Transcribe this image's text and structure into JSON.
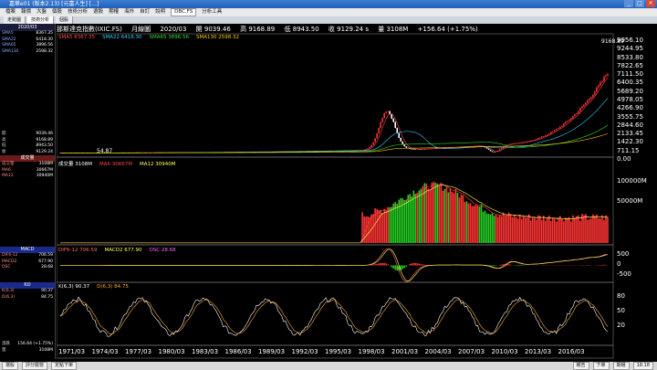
{
  "window": {
    "title": "嘉華e01 (版本2.13) [元富人生] [...]"
  },
  "menu": {
    "items": [
      "檔案",
      "報價",
      "大盤",
      "個股",
      "技術分析",
      "選股",
      "期權",
      "海外",
      "自訂",
      "說明"
    ],
    "symbol_value": "DBC.FS",
    "analysis_tool": "分析工具"
  },
  "tabs": [
    {
      "label": "走勢圖",
      "active": false
    },
    {
      "label": "技術分析",
      "active": true
    },
    {
      "label": "個股",
      "active": false
    }
  ],
  "header": {
    "name": "那斯達克指數(IXIC.FS)",
    "period": "月線圖",
    "date": "2020/03",
    "open_label": "開",
    "open": "9039.46",
    "high_label": "高",
    "high": "9168.89",
    "low_label": "低",
    "low": "8943.50",
    "close_label": "收",
    "close": "9129.24 s",
    "vol_label": "量",
    "vol": "3108M",
    "change": "+156.64 (+1.75%)"
  },
  "price_indicators": [
    {
      "label": "SMA5 8367.35",
      "color": "#ff4444"
    },
    {
      "label": "SMA22 6418.30",
      "color": "#33ccff"
    },
    {
      "label": "SMA65 3896.56",
      "color": "#33dd33"
    },
    {
      "label": "SMA130 2598.32",
      "color": "#ffcc00"
    }
  ],
  "vol_indicators": [
    {
      "label": "成交量 3108M",
      "color": "#ffffff"
    },
    {
      "label": "MA6 30667M",
      "color": "#ff4444"
    },
    {
      "label": "MA12 30940M",
      "color": "#ffff55"
    }
  ],
  "macd_indicators": [
    {
      "label": "DIF6-12 706.59",
      "color": "#ff6666"
    },
    {
      "label": "MACD2 677.90",
      "color": "#ffff55"
    },
    {
      "label": "OSC 28.68",
      "color": "#ff66ff"
    }
  ],
  "kd_indicators": [
    {
      "label": "K(6,3) 90.37",
      "color": "#ffffff"
    },
    {
      "label": "D(6,3) 84.75",
      "color": "#ffaa33"
    }
  ],
  "price_axis": [
    "9956.10",
    "9244.95",
    "8533.80",
    "7822.65",
    "7111.50",
    "6400.35",
    "5689.20",
    "4978.05",
    "4266.90",
    "3555.75",
    "2844.60",
    "2133.45",
    "1422.30",
    "711.15",
    "0.00"
  ],
  "price_max_label": "9168.89",
  "price_min_label": "54.87",
  "vol_axis": [
    "100000M",
    "50000M"
  ],
  "macd_axis": [
    "500",
    "0",
    "-500"
  ],
  "kd_axis": [
    "80",
    "50",
    "20"
  ],
  "x_axis": [
    "1971/03",
    "1974/03",
    "1977/03",
    "1980/03",
    "1983/03",
    "1986/03",
    "1989/03",
    "1992/03",
    "1995/03",
    "1998/03",
    "2001/03",
    "2004/03",
    "2007/03",
    "2010/03",
    "2013/03",
    "2016/03"
  ],
  "left_panel": {
    "date": "2020/03",
    "sma_rows": [
      [
        "SMA5",
        "8367.35"
      ],
      [
        "SMA22",
        "6418.30"
      ],
      [
        "SMA65",
        "3896.56"
      ],
      [
        "SMA130",
        "2598.32"
      ]
    ],
    "ohlc_rows": [
      [
        "開",
        "9039.46"
      ],
      [
        "高",
        "9168.89"
      ],
      [
        "低",
        "8943.50"
      ],
      [
        "收",
        "9129.24"
      ]
    ],
    "vol_title": "成交量",
    "vol_rows": [
      [
        "成交量",
        "3108M"
      ],
      [
        "MA6",
        "30667M"
      ],
      [
        "MA12",
        "30940M"
      ]
    ],
    "macd_title": "MACD",
    "macd_rows": [
      [
        "DIF6-12",
        "706.59"
      ],
      [
        "MACD2",
        "677.90"
      ],
      [
        "OSC",
        "28.68"
      ]
    ],
    "kd_title": "KD",
    "kd_rows": [
      [
        "K(6,3)",
        "90.37"
      ],
      [
        "D(6,3)",
        "84.75"
      ]
    ],
    "bottom_rows": [
      [
        "漲跌",
        "156.64 (+1.75%)"
      ],
      [
        "量",
        "3108M"
      ]
    ]
  },
  "status": {
    "items": [
      "選股",
      "評分擺營",
      "定點下單"
    ],
    "right": [
      "報告",
      "下單",
      "期權",
      "18:18"
    ]
  }
}
